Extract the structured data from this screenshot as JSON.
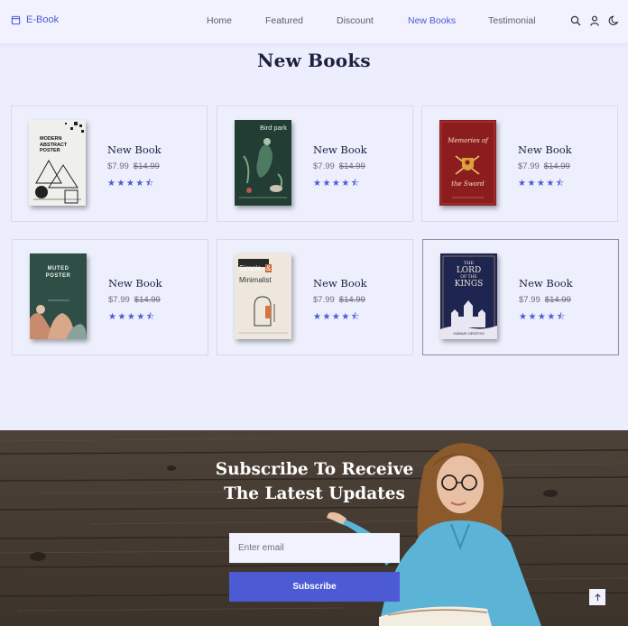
{
  "header": {
    "logo_text": "E-Book",
    "nav": [
      "Home",
      "Featured",
      "Discount",
      "New Books",
      "Testimonial"
    ],
    "active_nav": "New Books",
    "icons": [
      "search-icon",
      "user-icon",
      "moon-icon"
    ]
  },
  "section": {
    "title": "New Books"
  },
  "books": [
    {
      "name": "New Book",
      "price": "$7.99",
      "old_price": "$14.99",
      "stars": "★★★★⯪",
      "cover": "modern-abstract-poster-cover",
      "cover_text": [
        "MODERN",
        "ABSTRACT",
        "POSTER"
      ]
    },
    {
      "name": "New Book",
      "price": "$7.99",
      "old_price": "$14.99",
      "stars": "★★★★⯪",
      "cover": "bird-park-cover",
      "cover_text": [
        "Bird park"
      ]
    },
    {
      "name": "New Book",
      "price": "$7.99",
      "old_price": "$14.99",
      "stars": "★★★★⯪",
      "cover": "memories-of-the-sword-cover",
      "cover_text": [
        "Memories of",
        "the Sword"
      ]
    },
    {
      "name": "New Book",
      "price": "$7.99",
      "old_price": "$14.99",
      "stars": "★★★★⯪",
      "cover": "muted-poster-cover",
      "cover_text": [
        "MUTED",
        "POSTER"
      ]
    },
    {
      "name": "New Book",
      "price": "$7.99",
      "old_price": "$14.99",
      "stars": "★★★★⯪",
      "cover": "simple-minimalist-cover",
      "cover_text": [
        "Simple",
        "&",
        "Minimalist"
      ]
    },
    {
      "name": "New Book",
      "price": "$7.99",
      "old_price": "$14.99",
      "stars": "★★★★⯪",
      "cover": "lord-of-the-kings-cover",
      "cover_text": [
        "THE",
        "LORD",
        "OF THE",
        "KINGS",
        "SARAH GESTON"
      ]
    }
  ],
  "subscribe": {
    "title_line1": "Subscribe To Receive",
    "title_line2": "The Latest Updates",
    "email_placeholder": "Enter email",
    "button_label": "Subscribe"
  },
  "colors": {
    "accent": "#4c5bd4",
    "background": "#eceefd",
    "heading": "#1c2140"
  }
}
